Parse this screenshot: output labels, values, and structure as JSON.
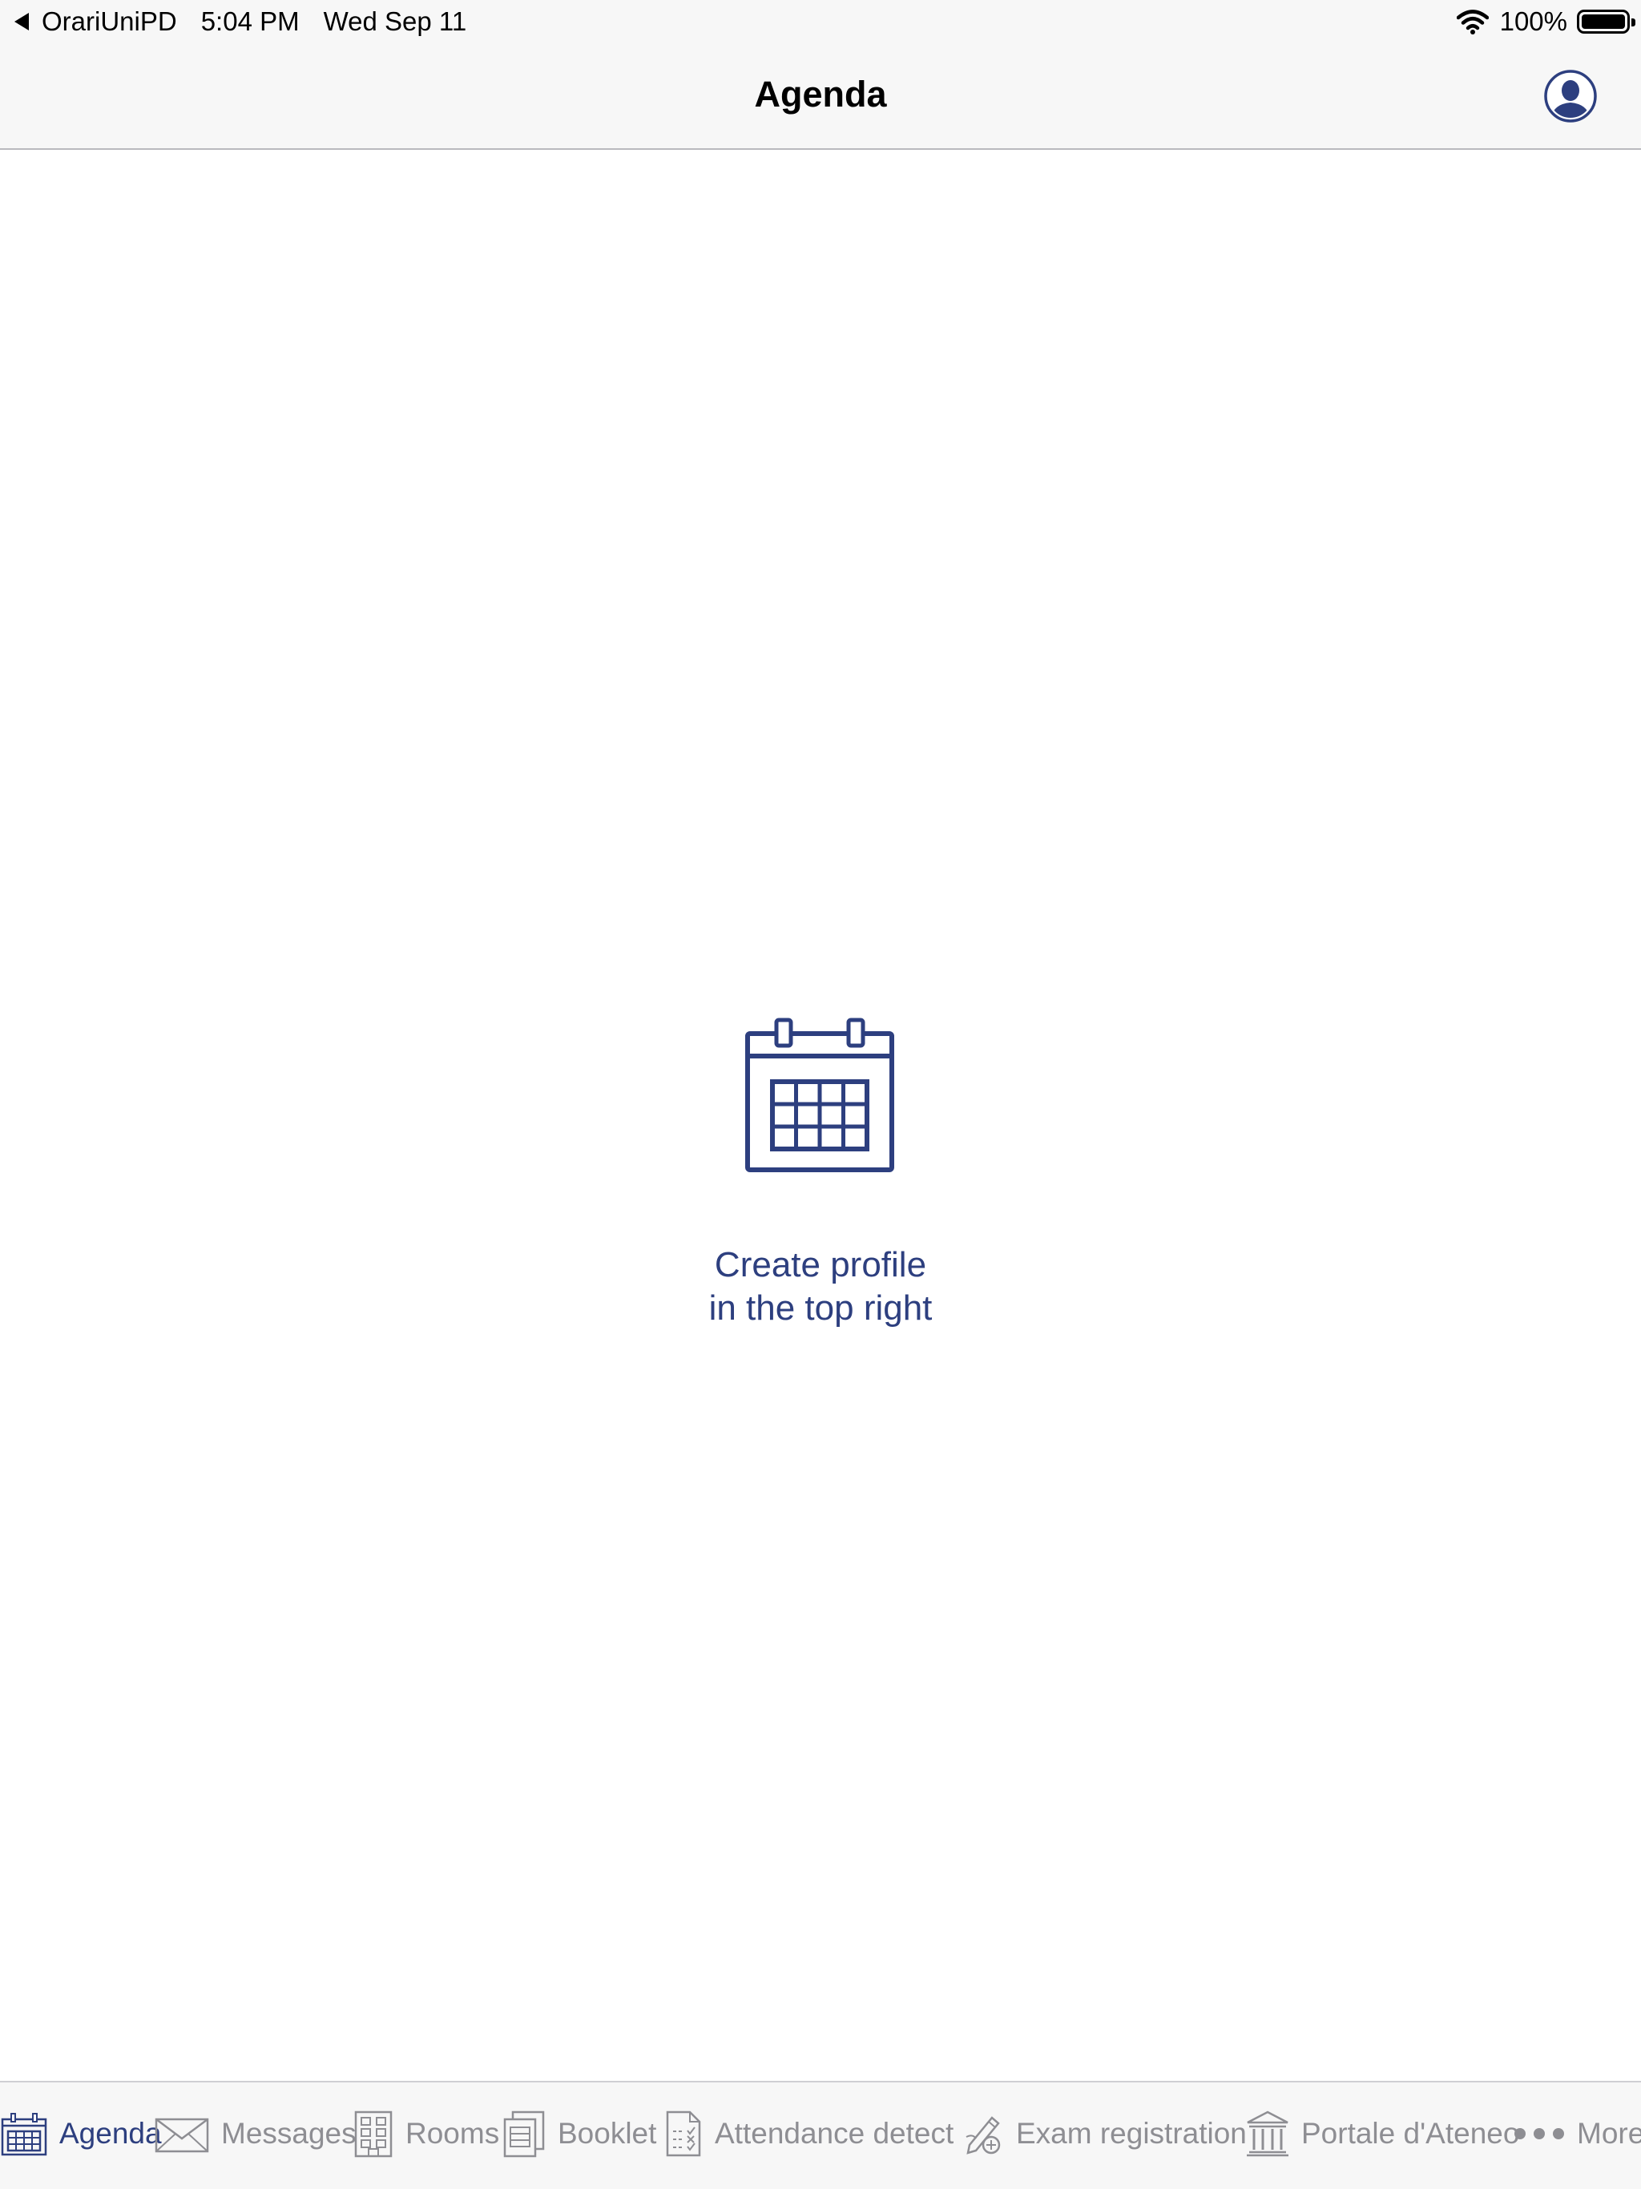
{
  "status_bar": {
    "back_app": "OrariUniPD",
    "time": "5:04 PM",
    "date": "Wed Sep 11",
    "battery": "100%"
  },
  "nav": {
    "title": "Agenda"
  },
  "empty_state": {
    "line1": "Create profile",
    "line2": "in the top right"
  },
  "tabs": [
    {
      "label": "Agenda",
      "icon": "calendar-icon",
      "active": true
    },
    {
      "label": "Messages",
      "icon": "envelope-icon",
      "active": false
    },
    {
      "label": "Rooms",
      "icon": "building-icon",
      "active": false
    },
    {
      "label": "Booklet",
      "icon": "booklet-icon",
      "active": false
    },
    {
      "label": "Attendance detect",
      "icon": "checklist-icon",
      "active": false
    },
    {
      "label": "Exam registration",
      "icon": "pen-icon",
      "active": false
    },
    {
      "label": "Portale d'Ateneo",
      "icon": "institution-icon",
      "active": false
    },
    {
      "label": "More",
      "icon": "more-icon",
      "active": false
    }
  ],
  "colors": {
    "accent": "#2d3f7f",
    "inactive": "#8e8e93",
    "bar_bg": "#f7f7f7"
  }
}
